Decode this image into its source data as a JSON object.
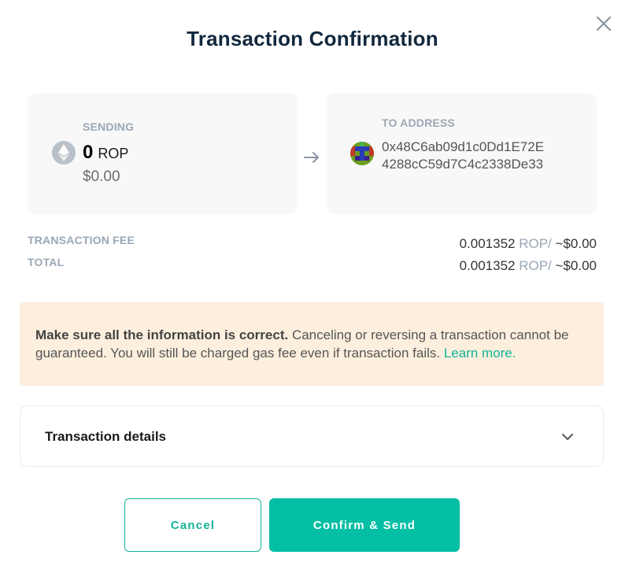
{
  "title": "Transaction Confirmation",
  "sending": {
    "label": "SENDING",
    "amount": "0",
    "unit": "ROP",
    "fiat": "$0.00",
    "icon": "ethereum-icon"
  },
  "to": {
    "label": "TO ADDRESS",
    "address": "0x48C6ab09d1c0Dd1E72E4288cC59d7C4c2338De33",
    "icon": "identicon-avatar"
  },
  "fees": [
    {
      "label": "TRANSACTION FEE",
      "amount": "0.001352",
      "unit": "ROP/",
      "fiat": "~$0.00"
    },
    {
      "label": "TOTAL",
      "amount": "0.001352",
      "unit": "ROP/",
      "fiat": "~$0.00"
    }
  ],
  "warning": {
    "bold": "Make sure all the information is correct.",
    "text": " Canceling or reversing a transaction cannot be guaranteed. You will still be charged gas fee even if transaction fails. ",
    "link": "Learn more."
  },
  "details": {
    "label": "Transaction details"
  },
  "buttons": {
    "cancel": "Cancel",
    "confirm": "Confirm & Send"
  },
  "colors": {
    "accent": "#04bfa4",
    "warning_bg": "#fcefdd",
    "title": "#12283d"
  }
}
